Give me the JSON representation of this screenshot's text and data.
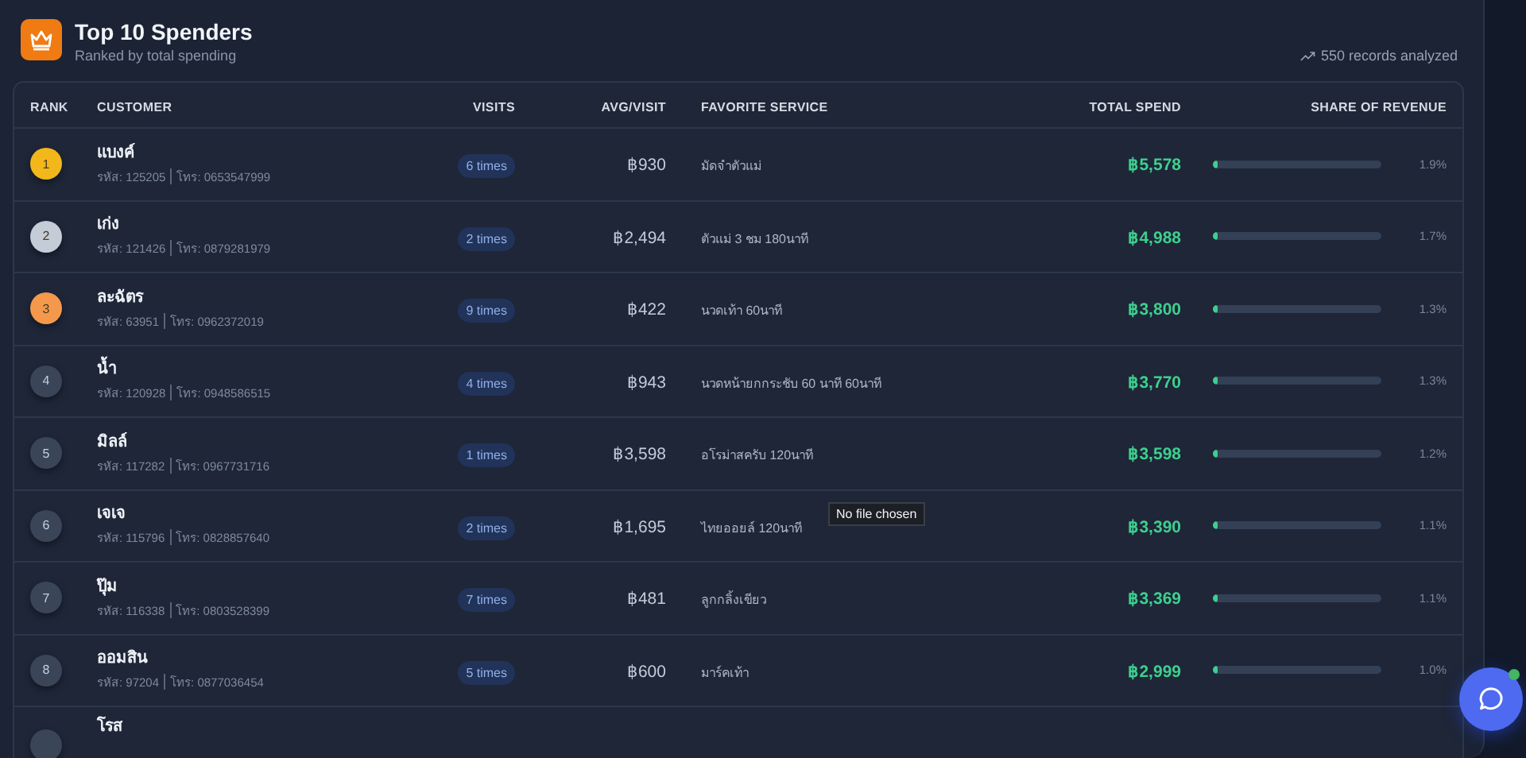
{
  "header": {
    "title": "Top 10 Spenders",
    "subtitle": "Ranked by total spending",
    "records": "550 records analyzed"
  },
  "table": {
    "columns": [
      "RANK",
      "CUSTOMER",
      "VISITS",
      "AVG/VISIT",
      "FAVORITE SERVICE",
      "TOTAL SPEND",
      "SHARE OF REVENUE"
    ],
    "rows": [
      {
        "rank": "1",
        "color": "#f2b81b",
        "name": "แบงค์",
        "code": "รหัส: 125205",
        "phone": "โทร: 0653547999",
        "visits": "6 times",
        "avg": "฿930",
        "service": "มัดจำตัวแม่",
        "total": "฿5,578",
        "level": 0.019,
        "share": "1.9%"
      },
      {
        "rank": "2",
        "color": "#c4ccd8",
        "name": "เก่ง",
        "code": "รหัส: 121426",
        "phone": "โทร: 0879281979",
        "visits": "2 times",
        "avg": "฿2,494",
        "service": "ตัวแม่ 3 ชม 180นาที",
        "total": "฿4,988",
        "level": 0.017,
        "share": "1.7%"
      },
      {
        "rank": "3",
        "color": "#f4994c",
        "name": "ละฉัตร",
        "code": "รหัส: 63951",
        "phone": "โทร: 0962372019",
        "visits": "9 times",
        "avg": "฿422",
        "service": "นวดเท้า 60นาที",
        "total": "฿3,800",
        "level": 0.013,
        "share": "1.3%"
      },
      {
        "rank": "4",
        "color": "#3a4558",
        "name": "น้ำ",
        "code": "รหัส: 120928",
        "phone": "โทร: 0948586515",
        "visits": "4 times",
        "avg": "฿943",
        "service": "นวดหน้ายกกระชับ 60 นาที 60นาที",
        "total": "฿3,770",
        "level": 0.013,
        "share": "1.3%"
      },
      {
        "rank": "5",
        "color": "#3a4558",
        "name": "มิลล์",
        "code": "รหัส: 117282",
        "phone": "โทร: 0967731716",
        "visits": "1 times",
        "avg": "฿3,598",
        "service": "อโรม่าสครับ 120นาที",
        "total": "฿3,598",
        "level": 0.012,
        "share": "1.2%"
      },
      {
        "rank": "6",
        "color": "#3a4558",
        "name": "เจเจ",
        "code": "รหัส: 115796",
        "phone": "โทร: 0828857640",
        "visits": "2 times",
        "avg": "฿1,695",
        "service": "ไทยออยล์ 120นาที",
        "tooltip": "No file chosen",
        "total": "฿3,390",
        "level": 0.011,
        "share": "1.1%"
      },
      {
        "rank": "7",
        "color": "#3a4558",
        "name": "ปุ๊ม",
        "code": "รหัส: 116338",
        "phone": "โทร: 0803528399",
        "visits": "7 times",
        "avg": "฿481",
        "service": "ลูกกลิ้งเขียว",
        "total": "฿3,369",
        "level": 0.011,
        "share": "1.1%"
      },
      {
        "rank": "8",
        "color": "#3a4558",
        "name": "ออมสิน",
        "code": "รหัส: 97204",
        "phone": "โทร: 0877036454",
        "visits": "5 times",
        "avg": "฿600",
        "service": "มาร์คเท้า",
        "total": "฿2,999",
        "level": 0.01,
        "share": "1.0%"
      },
      {
        "color": "#3a4558",
        "name": "โรส"
      }
    ]
  }
}
